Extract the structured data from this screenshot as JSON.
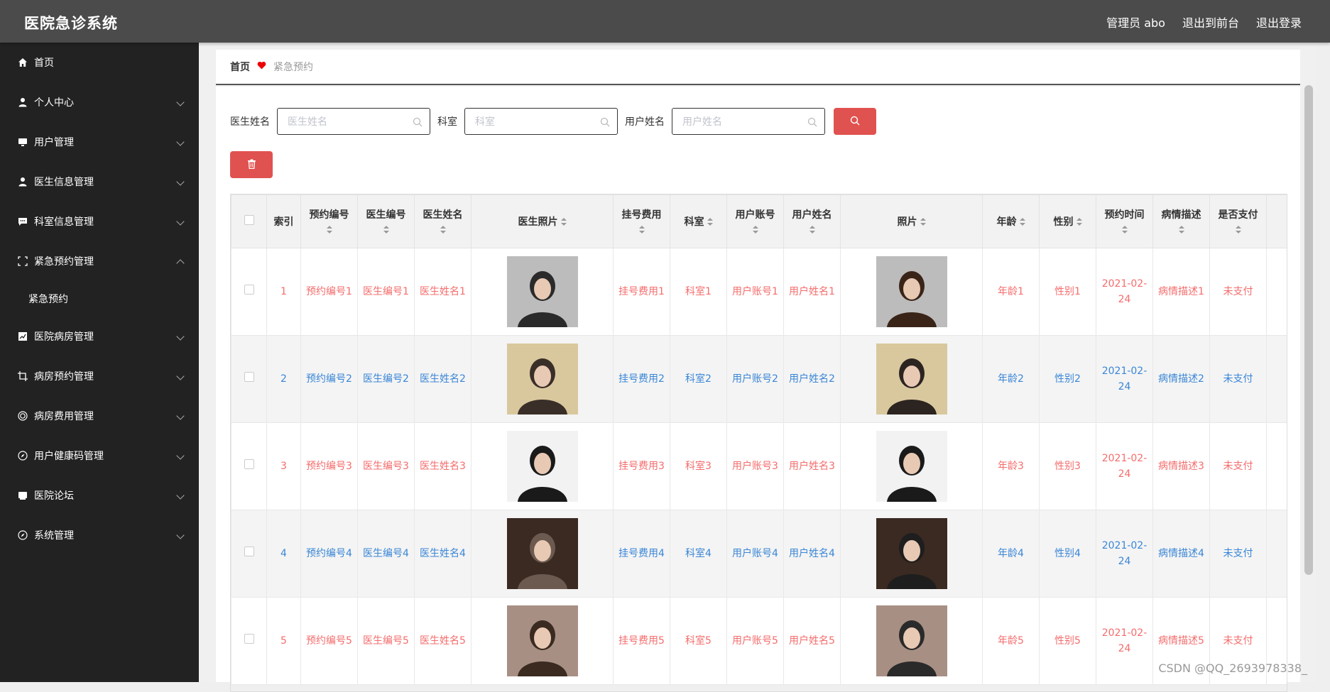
{
  "header": {
    "title": "医院急诊系统",
    "nav": [
      "管理员 abo",
      "退出到前台",
      "退出登录"
    ]
  },
  "sidebar": {
    "items": [
      {
        "label": "首页",
        "icon": "home-icon",
        "arrow": ""
      },
      {
        "label": "个人中心",
        "icon": "user-icon",
        "arrow": "down"
      },
      {
        "label": "用户管理",
        "icon": "monitor-icon",
        "arrow": "down"
      },
      {
        "label": "医生信息管理",
        "icon": "user-icon",
        "arrow": "down"
      },
      {
        "label": "科室信息管理",
        "icon": "chat-icon",
        "arrow": "down"
      },
      {
        "label": "紧急预约管理",
        "icon": "fullscreen-icon",
        "arrow": "up"
      },
      {
        "label": "紧急预约",
        "sub": true
      },
      {
        "label": "医院病房管理",
        "icon": "chart-icon",
        "arrow": "down"
      },
      {
        "label": "病房预约管理",
        "icon": "crop-icon",
        "arrow": "down"
      },
      {
        "label": "病房费用管理",
        "icon": "target-icon",
        "arrow": "down"
      },
      {
        "label": "用户健康码管理",
        "icon": "compass-icon",
        "arrow": "down"
      },
      {
        "label": "医院论坛",
        "icon": "forum-icon",
        "arrow": "down"
      },
      {
        "label": "系统管理",
        "icon": "compass-icon",
        "arrow": "down"
      }
    ]
  },
  "breadcrumb": {
    "home": "首页",
    "current": "紧急预约"
  },
  "search": {
    "doctor_label": "医生姓名",
    "doctor_placeholder": "医生姓名",
    "dept_label": "科室",
    "dept_placeholder": "科室",
    "user_label": "用户姓名",
    "user_placeholder": "用户姓名"
  },
  "table": {
    "headers": [
      "索引",
      "预约编号",
      "医生编号",
      "医生姓名",
      "医生照片",
      "挂号费用",
      "科室",
      "用户账号",
      "用户姓名",
      "照片",
      "年龄",
      "性别",
      "预约时间",
      "病情描述",
      "是否支付"
    ],
    "rows": [
      {
        "index": "1",
        "appt_no": "预约编号1",
        "doc_no": "医生编号1",
        "doc_name": "医生姓名1",
        "fee": "挂号费用1",
        "dept": "科室1",
        "account": "用户账号1",
        "user_name": "用户姓名1",
        "age": "年龄1",
        "gender": "性别1",
        "time": "2021-02-24",
        "desc": "病情描述1",
        "paid": "未支付"
      },
      {
        "index": "2",
        "appt_no": "预约编号2",
        "doc_no": "医生编号2",
        "doc_name": "医生姓名2",
        "fee": "挂号费用2",
        "dept": "科室2",
        "account": "用户账号2",
        "user_name": "用户姓名2",
        "age": "年龄2",
        "gender": "性别2",
        "time": "2021-02-24",
        "desc": "病情描述2",
        "paid": "未支付"
      },
      {
        "index": "3",
        "appt_no": "预约编号3",
        "doc_no": "医生编号3",
        "doc_name": "医生姓名3",
        "fee": "挂号费用3",
        "dept": "科室3",
        "account": "用户账号3",
        "user_name": "用户姓名3",
        "age": "年龄3",
        "gender": "性别3",
        "time": "2021-02-24",
        "desc": "病情描述3",
        "paid": "未支付"
      },
      {
        "index": "4",
        "appt_no": "预约编号4",
        "doc_no": "医生编号4",
        "doc_name": "医生姓名4",
        "fee": "挂号费用4",
        "dept": "科室4",
        "account": "用户账号4",
        "user_name": "用户姓名4",
        "age": "年龄4",
        "gender": "性别4",
        "time": "2021-02-24",
        "desc": "病情描述4",
        "paid": "未支付"
      },
      {
        "index": "5",
        "appt_no": "预约编号5",
        "doc_no": "医生编号5",
        "doc_name": "医生姓名5",
        "fee": "挂号费用5",
        "dept": "科室5",
        "account": "用户账号5",
        "user_name": "用户姓名5",
        "age": "年龄5",
        "gender": "性别5",
        "time": "2021-02-24",
        "desc": "病情描述5",
        "paid": "未支付"
      }
    ]
  },
  "colors": {
    "accent": "#e0524f",
    "odd_text": "#f56c6c",
    "even_text": "#3a86d6",
    "sidebar_bg": "#222222",
    "topbar_bg": "#4b4b4b"
  },
  "watermark": "CSDN @QQ_2693978338_"
}
